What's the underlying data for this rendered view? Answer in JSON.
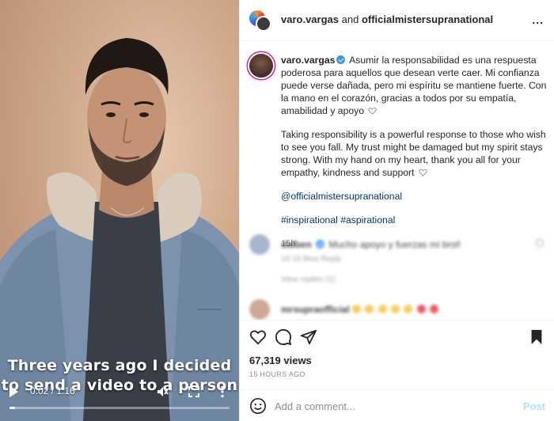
{
  "video": {
    "caption_line1": "Three years ago I decided",
    "caption_line2": "to send a video to a person",
    "time": "0:02 / 1:16",
    "progress": 0.026,
    "icons": [
      "play-icon",
      "mute-icon",
      "fullscreen-icon",
      "more-icon"
    ]
  },
  "header": {
    "user1": "varo.vargas",
    "connector": "and",
    "user2": "officialmistersupranational",
    "more": "..."
  },
  "caption": {
    "username": "varo.vargas",
    "spanish": "Asumir la responsabilidad es una respuesta poderosa para aquellos que desean verte caer. Mi confianza puede verse dañada, pero mi espíritu se mantiene fuerte. Con la mano en el corazón, gracias a todos por su empatía, amabilidad y apoyo",
    "english": "Taking responsibility is a powerful response to those who wish to see you fall. My trust might be damaged but my spirit stays strong. With my hand on my heart, thank you all for your empathy, kindness and support",
    "mention": "@officialmistersupranational",
    "hashtags": "#inspirational #aspirational",
    "time": "15h"
  },
  "comments": [
    {
      "user": "dalben",
      "text": "Mucho apoyo y fuerzas mi brol!",
      "meta": "1d   15 likes   Reply",
      "replies": "View replies (1)"
    },
    {
      "user": "mrsupraofficial",
      "text": "",
      "meta": ""
    }
  ],
  "stats": {
    "views": "67,319 views",
    "ago": "15 HOURS AGO"
  },
  "add_comment": {
    "placeholder": "Add a comment...",
    "post": "Post"
  },
  "colors": {
    "link": "#00376b",
    "verified": "#3897f0",
    "muted": "#8e8e8e",
    "post_disabled": "#b2dffc"
  }
}
